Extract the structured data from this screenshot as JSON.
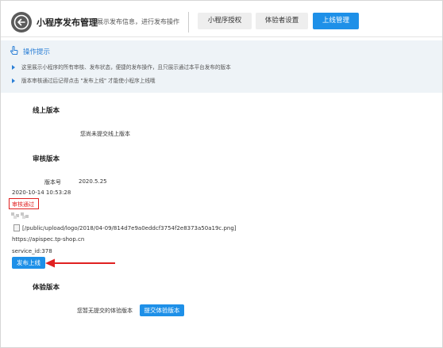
{
  "header": {
    "title": "小程序发布管理",
    "subtitle": "展示发布信息，进行发布操作",
    "tabs": [
      {
        "label": "小程序授权",
        "active": false
      },
      {
        "label": "体验者设置",
        "active": false
      },
      {
        "label": "上线管理",
        "active": true
      }
    ]
  },
  "tips": {
    "title": "操作提示",
    "lines": [
      "这里展示小程序的所有审核、发布状态，便捷的发布操作，且只展示通过本平台发布的版本",
      "版本审核通过后记得点击 \"发布上线\" 才能使小程序上线哦"
    ]
  },
  "online": {
    "title": "线上版本",
    "empty_text": "您尚未提交线上版本"
  },
  "audit": {
    "title": "审核版本",
    "version_label": "版本号",
    "version_value": "2020.5.25",
    "datetime": "2020-10-14 10:53:28",
    "status": "审核通过",
    "image_path": "[/public/upload/logo/2018/04-09/814d7e9a0eddcf3754f2e8373a50a19c.png]",
    "url": "https://apispec.tp-shop.cn",
    "service_id": "service_id:378",
    "publish_button": "发布上线"
  },
  "trial": {
    "title": "体验版本",
    "empty_text": "您暂无提交的体验版本",
    "submit_button": "提交体验版本"
  },
  "colors": {
    "accent": "#1e90e8",
    "status_red": "#e02020",
    "tips_bg": "#eef3f7"
  },
  "icons": {
    "back": "back-arrow-icon",
    "tips": "hand-pointer-icon",
    "bullet": "triangle-bullet-icon",
    "annotation": "red-arrow-icon"
  }
}
